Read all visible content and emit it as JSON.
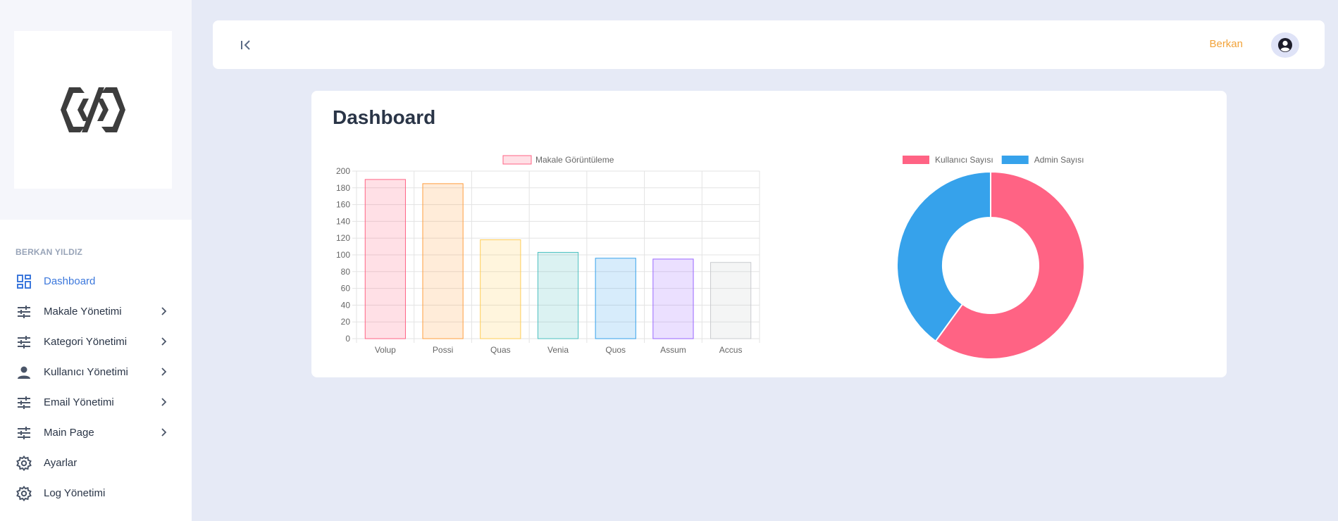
{
  "sidebar": {
    "section_title": "BERKAN YILDIZ",
    "items": [
      {
        "label": "Dashboard",
        "icon": "dashboard-icon",
        "active": true,
        "has_submenu": false
      },
      {
        "label": "Makale Yönetimi",
        "icon": "sliders-icon",
        "active": false,
        "has_submenu": true
      },
      {
        "label": "Kategori Yönetimi",
        "icon": "sliders-icon",
        "active": false,
        "has_submenu": true
      },
      {
        "label": "Kullanıcı Yönetimi",
        "icon": "person-icon",
        "active": false,
        "has_submenu": true
      },
      {
        "label": "Email Yönetimi",
        "icon": "sliders-icon",
        "active": false,
        "has_submenu": true
      },
      {
        "label": "Main Page",
        "icon": "sliders-icon",
        "active": false,
        "has_submenu": true
      },
      {
        "label": "Ayarlar",
        "icon": "gear-icon",
        "active": false,
        "has_submenu": false
      },
      {
        "label": "Log Yönetimi",
        "icon": "gear-icon",
        "active": false,
        "has_submenu": false
      }
    ]
  },
  "header": {
    "user_name": "Berkan"
  },
  "main": {
    "title": "Dashboard"
  },
  "colors": {
    "accent": "#3c78dc",
    "user_name": "#f2a33a",
    "pink": "#ff6384",
    "blue": "#36a2eb"
  },
  "chart_data": [
    {
      "type": "bar",
      "categories": [
        "Volup",
        "Possi",
        "Quas",
        "Venia",
        "Quos",
        "Assum",
        "Accus"
      ],
      "series": [
        {
          "name": "Makale Görüntüleme",
          "values": [
            190,
            185,
            118,
            103,
            96,
            95,
            91
          ]
        }
      ],
      "ylim": [
        0,
        200
      ],
      "yticks": [
        0,
        20,
        40,
        60,
        80,
        100,
        120,
        140,
        160,
        180,
        200
      ],
      "grid": true,
      "legend": "top",
      "bar_colors": [
        "#ff6384",
        "#ff9f40",
        "#ffcd56",
        "#4bc0c0",
        "#36a2eb",
        "#9966ff",
        "#c9cbcf"
      ]
    },
    {
      "type": "pie",
      "variant": "doughnut",
      "labels": [
        "Kullanıcı Sayısı",
        "Admin Sayısı"
      ],
      "values": [
        60,
        40
      ],
      "colors": [
        "#ff6384",
        "#36a2eb"
      ],
      "legend": "top"
    }
  ]
}
